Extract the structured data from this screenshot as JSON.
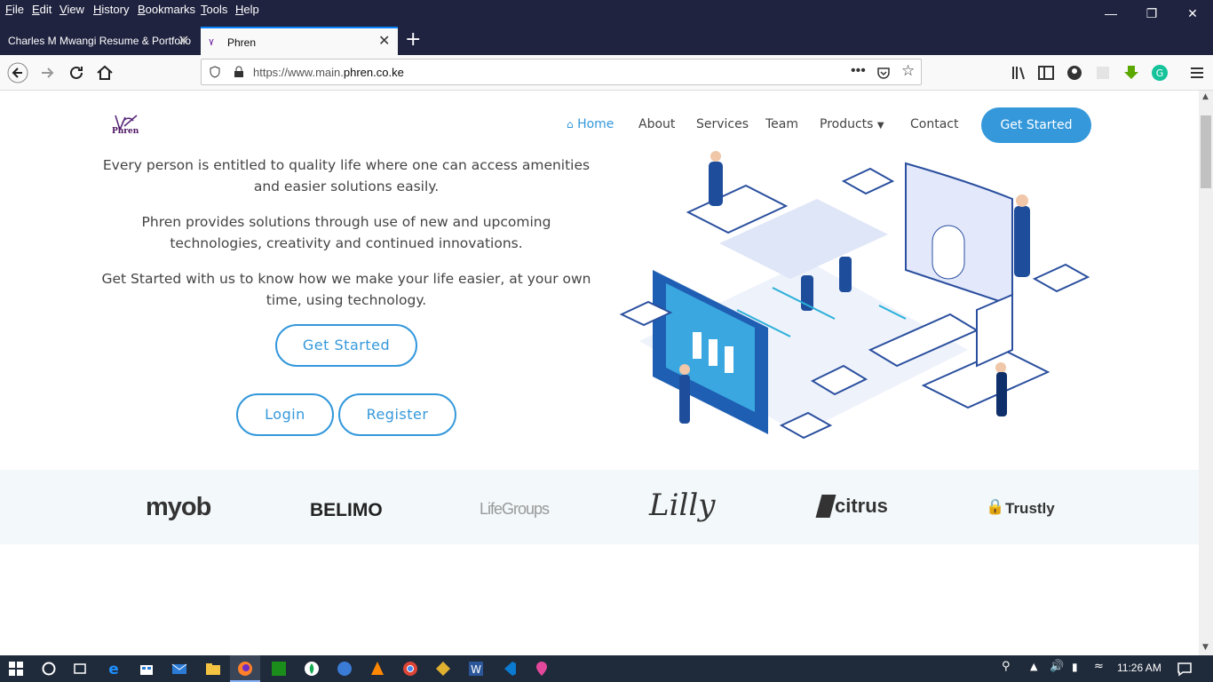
{
  "menubar": {
    "items": [
      "File",
      "Edit",
      "View",
      "History",
      "Bookmarks",
      "Tools",
      "Help"
    ]
  },
  "tabs": [
    {
      "title": "Charles M Mwangi Resume & Portfolio"
    },
    {
      "title": "Phren"
    }
  ],
  "url": {
    "prefix": "https://www.main.",
    "domain": "phren.co.ke"
  },
  "site": {
    "logo_text": "Phren",
    "nav": {
      "home": "Home",
      "about": "About",
      "services": "Services",
      "team": "Team",
      "products": "Products",
      "contact": "Contact"
    },
    "header_cta": "Get Started",
    "hero": {
      "p1": "Every person is entitled to quality life where one can access amenities and easier solutions easily.",
      "p2": "Phren provides solutions through use of new and upcoming technologies, creativity and continued innovations.",
      "p3": "Get Started with us to know how we make your life easier, at your own time, using technology.",
      "get_started": "Get Started",
      "login": "Login",
      "register": "Register"
    },
    "clients": [
      "myob",
      "BELIMO",
      "LifeGroups",
      "Lilly",
      "citrus",
      "Trustly"
    ]
  },
  "taskbar": {
    "time": "11:26 AM"
  },
  "colors": {
    "accent": "#3498db",
    "menubar": "#202340",
    "taskbar": "#1f2a3a"
  }
}
